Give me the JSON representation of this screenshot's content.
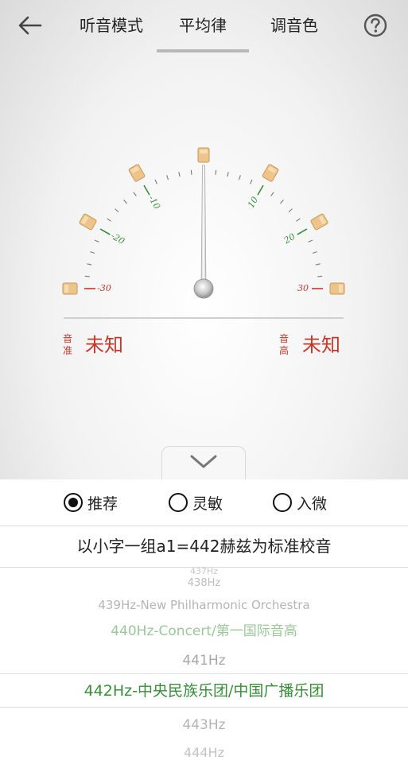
{
  "header": {
    "tabs": [
      {
        "label": "听音模式"
      },
      {
        "label": "平均律"
      },
      {
        "label": "调音色"
      }
    ]
  },
  "tuner": {
    "scale_labels": [
      "-30",
      "-20",
      "-10",
      "10",
      "20",
      "30"
    ],
    "left_label_chars": [
      "音",
      "准"
    ],
    "left_value": "未知",
    "right_label_chars": [
      "音",
      "高"
    ],
    "right_value": "未知",
    "needle_value": 0
  },
  "panel": {
    "modes": [
      {
        "label": "推荐",
        "selected": true
      },
      {
        "label": "灵敏",
        "selected": false
      },
      {
        "label": "入微",
        "selected": false
      }
    ],
    "standard_text": "以小字一组a1=442赫兹为标准校音",
    "frequencies": [
      "437Hz",
      "438Hz",
      "439Hz-New Philharmonic Orchestra",
      "440Hz-Concert/第一国际音高",
      "441Hz",
      "442Hz-中央民族乐团/中国广播乐团",
      "443Hz",
      "444Hz"
    ]
  },
  "colors": {
    "accent_green": "#3a8d3a",
    "warning_red": "#c0392b",
    "peg_color": "#edc48a"
  }
}
